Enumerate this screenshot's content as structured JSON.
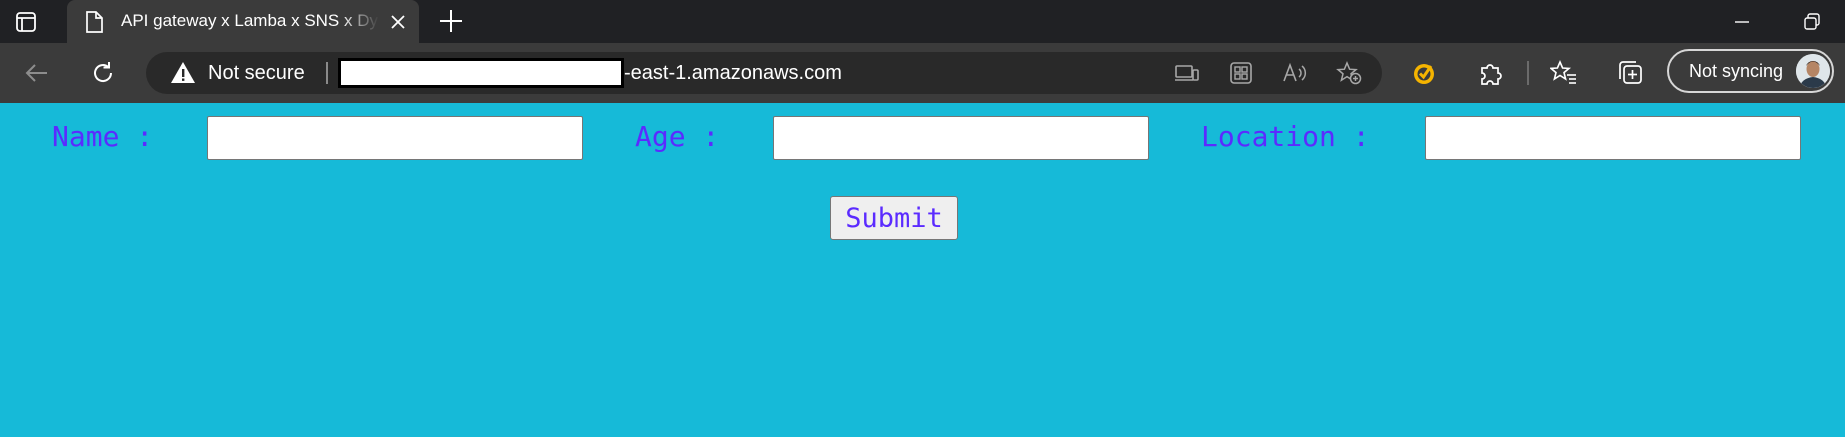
{
  "browser": {
    "tab": {
      "title": "API gateway x Lamba x SNS x DynamoDB"
    },
    "address_bar": {
      "security_label": "Not secure",
      "url_visible_suffix": "-east-1.amazonaws.com"
    },
    "profile": {
      "label": "Not syncing"
    },
    "icons": {
      "tab_actions": "tab-actions-icon",
      "favicon": "document-icon",
      "close": "close-icon",
      "new_tab": "plus-icon",
      "minimize": "minimize-icon",
      "restore": "restore-icon",
      "back": "back-arrow-icon",
      "reload": "reload-icon",
      "warning": "warning-icon",
      "extensions": "puzzle-icon",
      "favorites": "favorites-icon",
      "collections": "collections-icon"
    },
    "colors": {
      "tabstrip": "#202124",
      "toolbar": "#3b3b3b",
      "omnibox": "#292929"
    }
  },
  "page": {
    "background": "#16bad8",
    "label_color": "#5b2bff",
    "form": {
      "name_label": "Name :",
      "age_label": "Age :",
      "location_label": "Location :",
      "name_value": "",
      "age_value": "",
      "location_value": "",
      "submit_label": "Submit"
    }
  }
}
